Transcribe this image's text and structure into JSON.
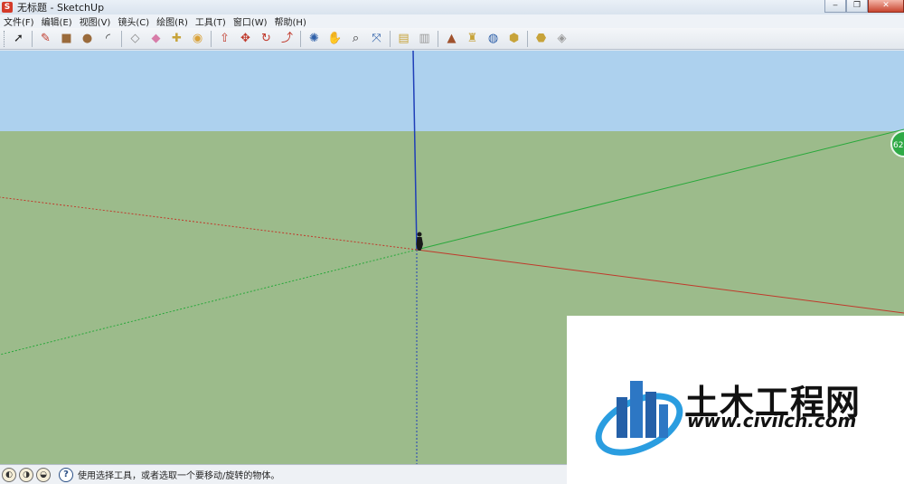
{
  "window": {
    "title": "无标题 - SketchUp",
    "app_icon": "sketchup-logo",
    "controls": [
      "minimize",
      "restore",
      "close"
    ]
  },
  "menu": [
    {
      "label": "文件(F)"
    },
    {
      "label": "编辑(E)"
    },
    {
      "label": "视图(V)"
    },
    {
      "label": "镜头(C)"
    },
    {
      "label": "绘图(R)"
    },
    {
      "label": "工具(T)"
    },
    {
      "label": "窗口(W)"
    },
    {
      "label": "帮助(H)"
    }
  ],
  "toolbar": {
    "tools": [
      {
        "name": "select-icon",
        "glyph": "➚",
        "color": "#222222"
      },
      {
        "name": "pencil-icon",
        "glyph": "✎",
        "color": "#c0392b"
      },
      {
        "name": "rectangle-icon",
        "glyph": "■",
        "color": "#9a6b3c"
      },
      {
        "name": "circle-icon",
        "glyph": "●",
        "color": "#9a6b3c"
      },
      {
        "name": "arc-icon",
        "glyph": "◜",
        "color": "#333333"
      },
      {
        "name": "make-component-icon",
        "glyph": "◇",
        "color": "#888888"
      },
      {
        "name": "eraser-icon",
        "glyph": "◆",
        "color": "#d77ca8"
      },
      {
        "name": "tape-measure-icon",
        "glyph": "✚",
        "color": "#c7a33a"
      },
      {
        "name": "paint-bucket-icon",
        "glyph": "◉",
        "color": "#d9a23a"
      },
      {
        "name": "push-pull-icon",
        "glyph": "⇧",
        "color": "#c0392b"
      },
      {
        "name": "move-icon",
        "glyph": "✥",
        "color": "#c0392b"
      },
      {
        "name": "rotate-icon",
        "glyph": "↻",
        "color": "#c0392b"
      },
      {
        "name": "offset-icon",
        "glyph": "⤴",
        "color": "#c0392b"
      },
      {
        "name": "orbit-icon",
        "glyph": "✺",
        "color": "#2d5fa8"
      },
      {
        "name": "pan-icon",
        "glyph": "✋",
        "color": "#444444"
      },
      {
        "name": "zoom-icon",
        "glyph": "⌕",
        "color": "#333333"
      },
      {
        "name": "zoom-extents-icon",
        "glyph": "⤧",
        "color": "#2d5fa8"
      },
      {
        "name": "previous-view-icon",
        "glyph": "▤",
        "color": "#c7a33a"
      },
      {
        "name": "next-view-icon",
        "glyph": "▥",
        "color": "#999999"
      },
      {
        "name": "add-location-icon",
        "glyph": "▲",
        "color": "#a0522d"
      },
      {
        "name": "toggle-terrain-icon",
        "glyph": "♜",
        "color": "#c7a33a"
      },
      {
        "name": "get-models-icon",
        "glyph": "◍",
        "color": "#2d5fa8"
      },
      {
        "name": "share-model-icon",
        "glyph": "⬢",
        "color": "#c7a33a"
      },
      {
        "name": "share-component-icon",
        "glyph": "⬣",
        "color": "#c7a33a"
      },
      {
        "name": "get-photo-texture-icon",
        "glyph": "◈",
        "color": "#999999"
      }
    ],
    "separators_after": [
      0,
      4,
      8,
      12,
      16,
      18,
      22
    ]
  },
  "viewport": {
    "sky_color": "#add1ee",
    "ground_color": "#9cbb8b",
    "axis_colors": {
      "red": "#c0392b",
      "green": "#27a83a",
      "blue": "#1f3fb8"
    },
    "figure": "person-silhouette",
    "edge_badge": "62"
  },
  "status": {
    "icons": [
      "geo-location-icon",
      "credits-icon",
      "user-icon"
    ],
    "text": "使用选择工具，或者选取一个要移动/旋转的物体。"
  },
  "watermark": {
    "name": "土木工程网",
    "url": "www.civilcn.com"
  }
}
